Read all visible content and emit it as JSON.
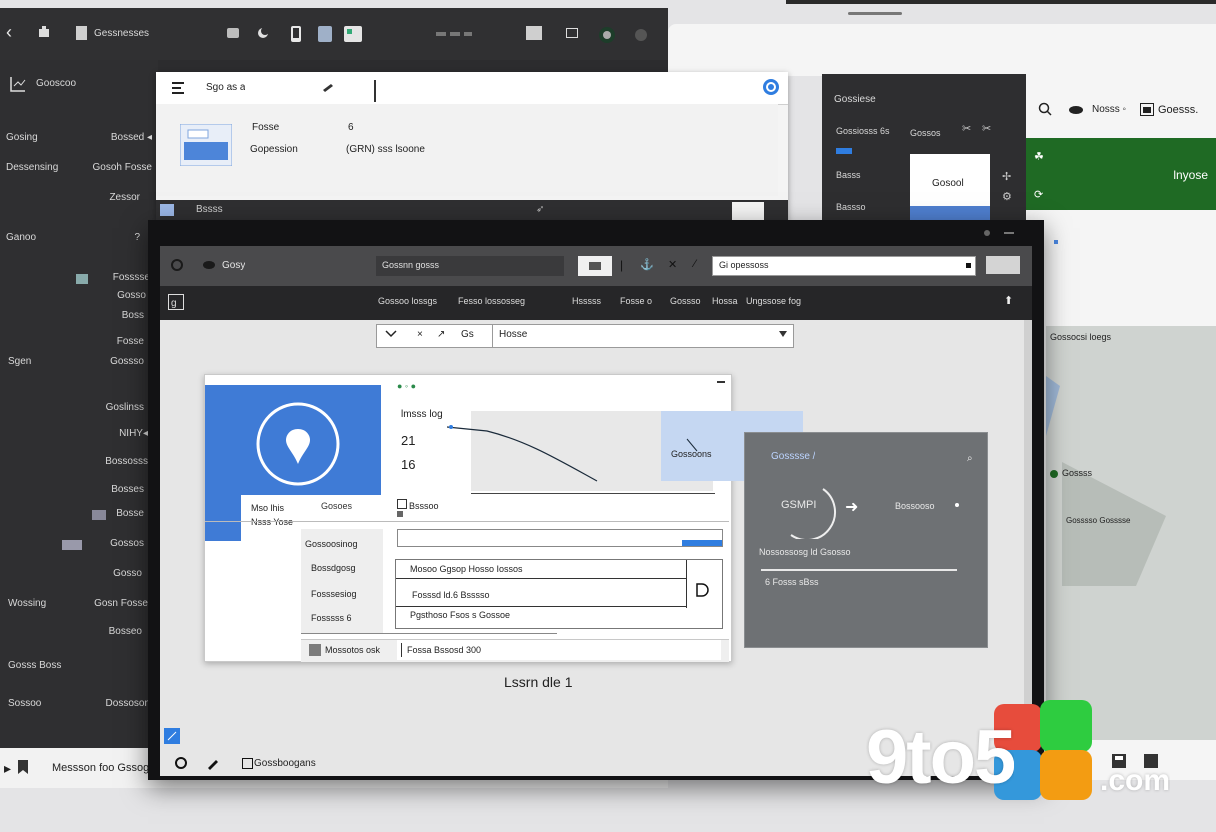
{
  "back_window": {
    "title": "Gessnesses",
    "sidebar_header": "Gooscoo",
    "sidebar": [
      {
        "left": "Gosing",
        "right": "Bossed ◂"
      },
      {
        "left": "Dessensing",
        "right": "Gosoh Fosse"
      },
      {
        "left": "",
        "right": "Zessor"
      },
      {
        "left": "Ganoo",
        "right": "?"
      },
      {
        "left": "",
        "right": "Fosssse"
      },
      {
        "left": "",
        "right": "Gosso"
      },
      {
        "left": "",
        "right": "Boss"
      },
      {
        "left": "",
        "right": "Fosse"
      },
      {
        "left": "Sgen",
        "right": "Gossso"
      },
      {
        "left": "",
        "right": "Goslinss"
      },
      {
        "left": "",
        "right": "NIHY◂"
      },
      {
        "left": "",
        "right": "Bossosss"
      },
      {
        "left": "",
        "right": "Bosses"
      },
      {
        "left": "",
        "right": "Bosse"
      },
      {
        "left": "",
        "right": "Gossos"
      },
      {
        "left": "",
        "right": "Gosso"
      },
      {
        "left": "Wossing",
        "right": "Gosn Fosse"
      },
      {
        "left": "",
        "right": "Bosseo"
      },
      {
        "left": "Gosss Boss",
        "right": ""
      },
      {
        "left": "Sossoo",
        "right": "Dossoson"
      }
    ],
    "bottom_text": "Messson foo Gssogss"
  },
  "sub_window": {
    "search": "Sgo as a",
    "row1_label": "Fosse",
    "row1_value": "6",
    "row2_label": "Gopession",
    "row2_value": "(GRN) sss lsoone",
    "strip_text": "Bssss"
  },
  "right_window": {
    "title": "Gossiese",
    "row1_a": "Gossiosss 6s",
    "row1_b": "Gossos",
    "row2": "Basss",
    "row3": "Bassso",
    "card_label": "Gosool",
    "toolbar_a": "Nosss ◦",
    "toolbar_b": "Goesss.",
    "green_text": "lnyose",
    "map_title": "Gossocsi loegs",
    "map_label_1": "Gossss",
    "map_label_2": "Gosssso Gosssse"
  },
  "main_window": {
    "top_left_label": "Gosy",
    "top_field": "Gossnn gosss",
    "url_field": "Gi opessoss",
    "menu_items": [
      "Gossoo lossgs",
      "Fesso lossosseg",
      "Hsssss",
      "Fosse o",
      "Gossso",
      "Hossa",
      "Ungssose fog"
    ],
    "combo_a": "Gs",
    "combo_b": "Hosse",
    "dialog": {
      "card_line1": "Mso lhis",
      "card_line2": "Nsss Yose",
      "tab_label": "Gosoes",
      "metric_label": "lmsss log",
      "metric_1": "21",
      "metric_2": "16",
      "chart_label": "Gossoons",
      "checkbox_label": "Bsssoo",
      "left_items": [
        "Gossoosinog",
        "Bossdgosg",
        "Fosssesiog",
        "Fosssss 6"
      ],
      "input_value": "",
      "list_rows": [
        "Mosoo Ggsop Hosso Iossos",
        "Fosssd ld.6 Bsssso",
        "Pgsthoso Fsos s Gossoe"
      ],
      "status_left": "Mossotos osk",
      "status_right": "Fossa Bssosd 300"
    },
    "panel": {
      "title": "Gosssse /",
      "circle_label": "GSMPI",
      "arrow_label": "Bossooso",
      "line1": "Nossossosg ld Gsosso",
      "line2": "6 Fosss sBss"
    },
    "caption": "Lssrn dle 1",
    "bottom_label": "Gossboogans"
  },
  "watermark": {
    "brand": "9to5",
    "suffix": ".com"
  }
}
